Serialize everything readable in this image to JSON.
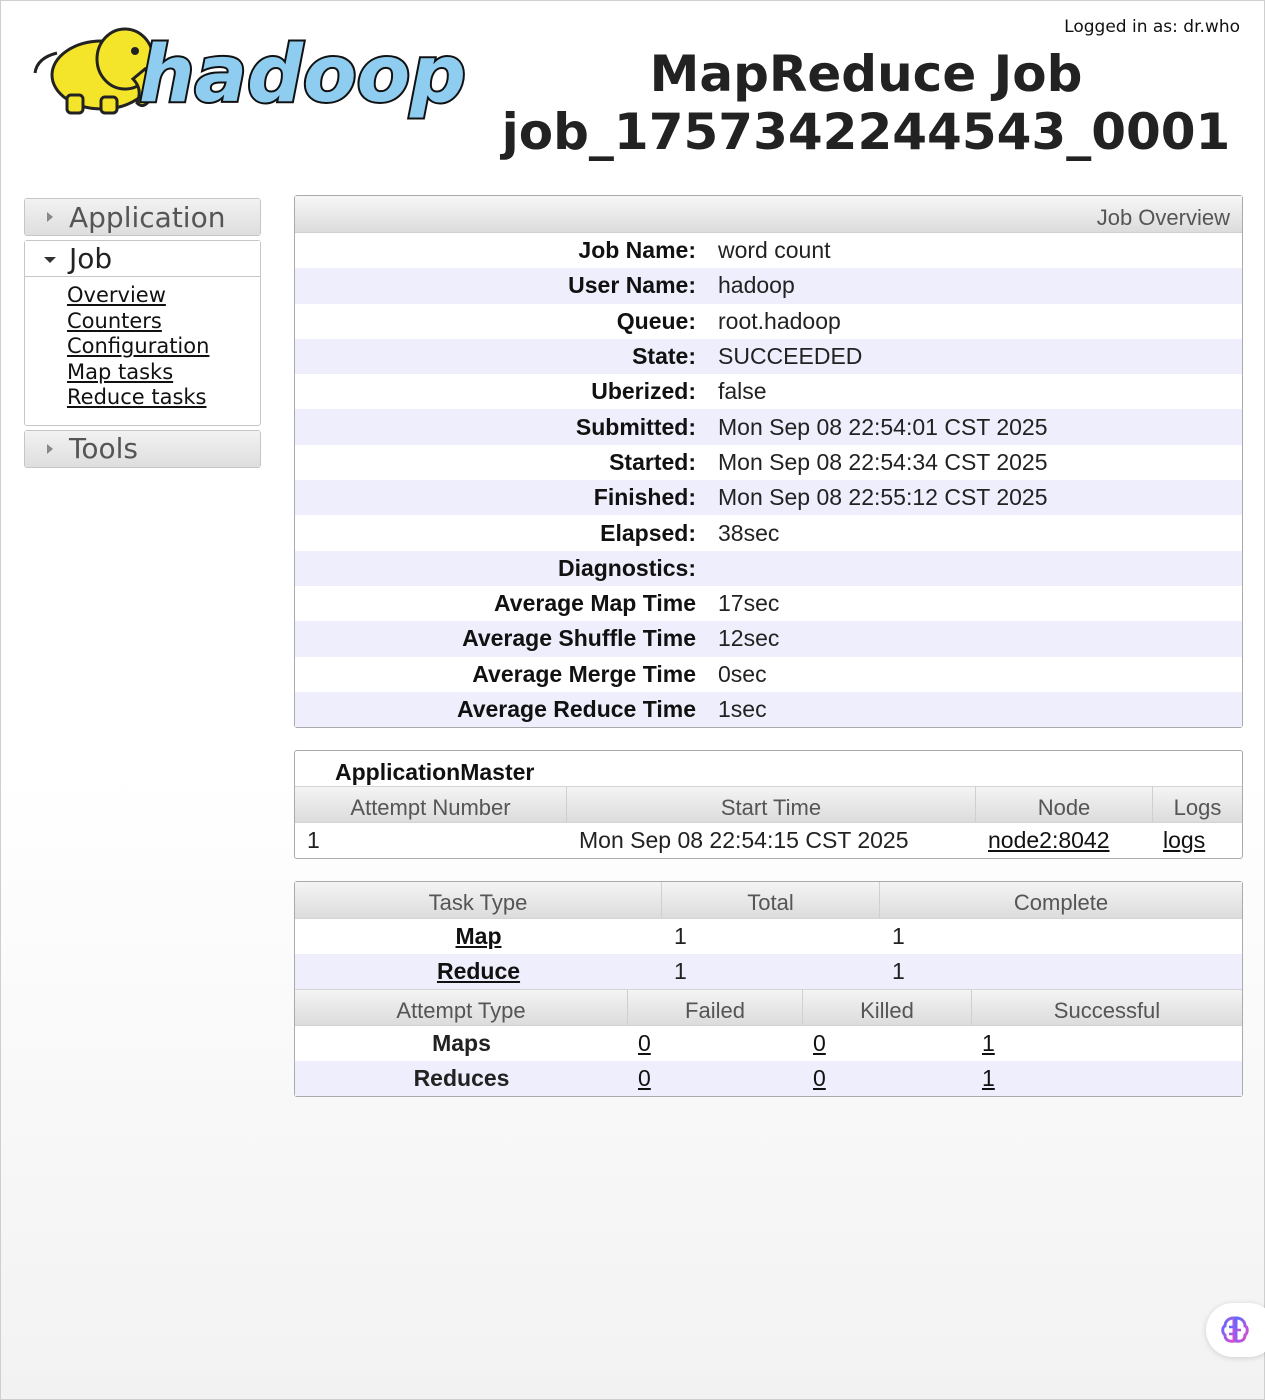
{
  "header": {
    "logged_in": "Logged in as: dr.who",
    "logo_text": "hadoop",
    "title_line1": "MapReduce Job",
    "title_line2": "job_1757342244543_0001"
  },
  "nav": {
    "application": "Application",
    "job": "Job",
    "job_links": [
      "Overview",
      "Counters",
      "Configuration",
      "Map tasks",
      "Reduce tasks"
    ],
    "tools": "Tools"
  },
  "overview": {
    "title": "Job Overview",
    "rows": [
      {
        "key": "Job Name:",
        "value": "word count"
      },
      {
        "key": "User Name:",
        "value": "hadoop"
      },
      {
        "key": "Queue:",
        "value": "root.hadoop"
      },
      {
        "key": "State:",
        "value": "SUCCEEDED"
      },
      {
        "key": "Uberized:",
        "value": "false"
      },
      {
        "key": "Submitted:",
        "value": "Mon Sep 08 22:54:01 CST 2025"
      },
      {
        "key": "Started:",
        "value": "Mon Sep 08 22:54:34 CST 2025"
      },
      {
        "key": "Finished:",
        "value": "Mon Sep 08 22:55:12 CST 2025"
      },
      {
        "key": "Elapsed:",
        "value": "38sec"
      },
      {
        "key": "Diagnostics:",
        "value": ""
      },
      {
        "key": "Average Map Time",
        "value": "17sec"
      },
      {
        "key": "Average Shuffle Time",
        "value": "12sec"
      },
      {
        "key": "Average Merge Time",
        "value": "0sec"
      },
      {
        "key": "Average Reduce Time",
        "value": "1sec"
      }
    ]
  },
  "app_master": {
    "title": "ApplicationMaster",
    "headers": [
      "Attempt Number",
      "Start Time",
      "Node",
      "Logs"
    ],
    "row": {
      "attempt": "1",
      "start": "Mon Sep 08 22:54:15 CST 2025",
      "node": "node2:8042",
      "logs": "logs"
    }
  },
  "tasks": {
    "headers": [
      "Task Type",
      "Total",
      "Complete"
    ],
    "rows": [
      {
        "type": "Map",
        "total": "1",
        "complete": "1"
      },
      {
        "type": "Reduce",
        "total": "1",
        "complete": "1"
      }
    ],
    "attempt_headers": [
      "Attempt Type",
      "Failed",
      "Killed",
      "Successful"
    ],
    "attempt_rows": [
      {
        "type": "Maps",
        "failed": "0",
        "killed": "0",
        "successful": "1"
      },
      {
        "type": "Reduces",
        "failed": "0",
        "killed": "0",
        "successful": "1"
      }
    ]
  },
  "colors": {
    "row_alt": "#eeeefc",
    "logo_blue": "#8ecdf0",
    "logo_yellow": "#f5e52a"
  },
  "icons": {
    "fab": "brain-icon"
  }
}
